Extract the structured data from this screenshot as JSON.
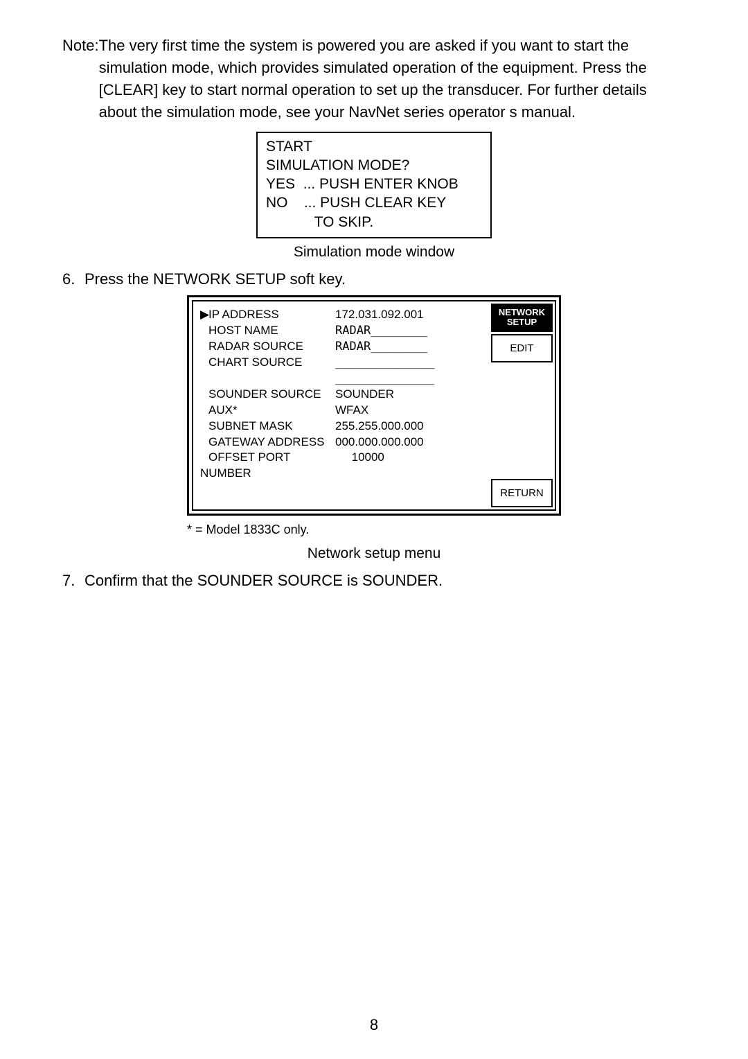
{
  "note": {
    "label": "Note: ",
    "text": "The very first time the system is powered you are asked if you want to start the simulation mode, which provides simulated operation of the equipment. Press the [CLEAR] key to start normal operation to set up the transducer. For further details about the simulation mode, see your NavNet series operator s manual."
  },
  "sim_box": {
    "l1": "START",
    "l2": "SIMULATION MODE?",
    "l3": "YES  ... PUSH ENTER KNOB",
    "l4": "NO    ... PUSH CLEAR KEY",
    "l5": "            TO SKIP."
  },
  "caption_sim": "Simulation mode window",
  "step6": {
    "num": "6.",
    "text": "Press the NETWORK SETUP soft key."
  },
  "network": {
    "rows": {
      "ip": {
        "label": "IP ADDRESS",
        "value": "172.031.092.001"
      },
      "host": {
        "label": "HOST NAME",
        "value": "RADAR________"
      },
      "radar_src": {
        "label": "RADAR SOURCE",
        "value": "RADAR________"
      },
      "chart_src": {
        "label": "CHART SOURCE",
        "value": "______________"
      },
      "blank": {
        "label": "",
        "value": "______________"
      },
      "sounder_src": {
        "label": "SOUNDER SOURCE",
        "value": "SOUNDER"
      },
      "aux": {
        "label": "AUX*",
        "value": "WFAX"
      },
      "subnet": {
        "label": "SUBNET MASK",
        "value": "255.255.000.000"
      },
      "gateway": {
        "label": "GATEWAY ADDRESS",
        "value": "000.000.000.000"
      },
      "offset": {
        "label": "OFFSET PORT NUMBER",
        "value": "     10000"
      }
    },
    "sidebar": {
      "title_l1": "NETWORK",
      "title_l2": "SETUP",
      "edit": "EDIT",
      "return": "RETURN"
    }
  },
  "footnote": "* = Model 1833C only.",
  "caption_net": "Network setup menu",
  "step7": {
    "num": "7.",
    "text": "Confirm that the  SOUNDER SOURCE  is SOUNDER."
  },
  "page_number": "8"
}
